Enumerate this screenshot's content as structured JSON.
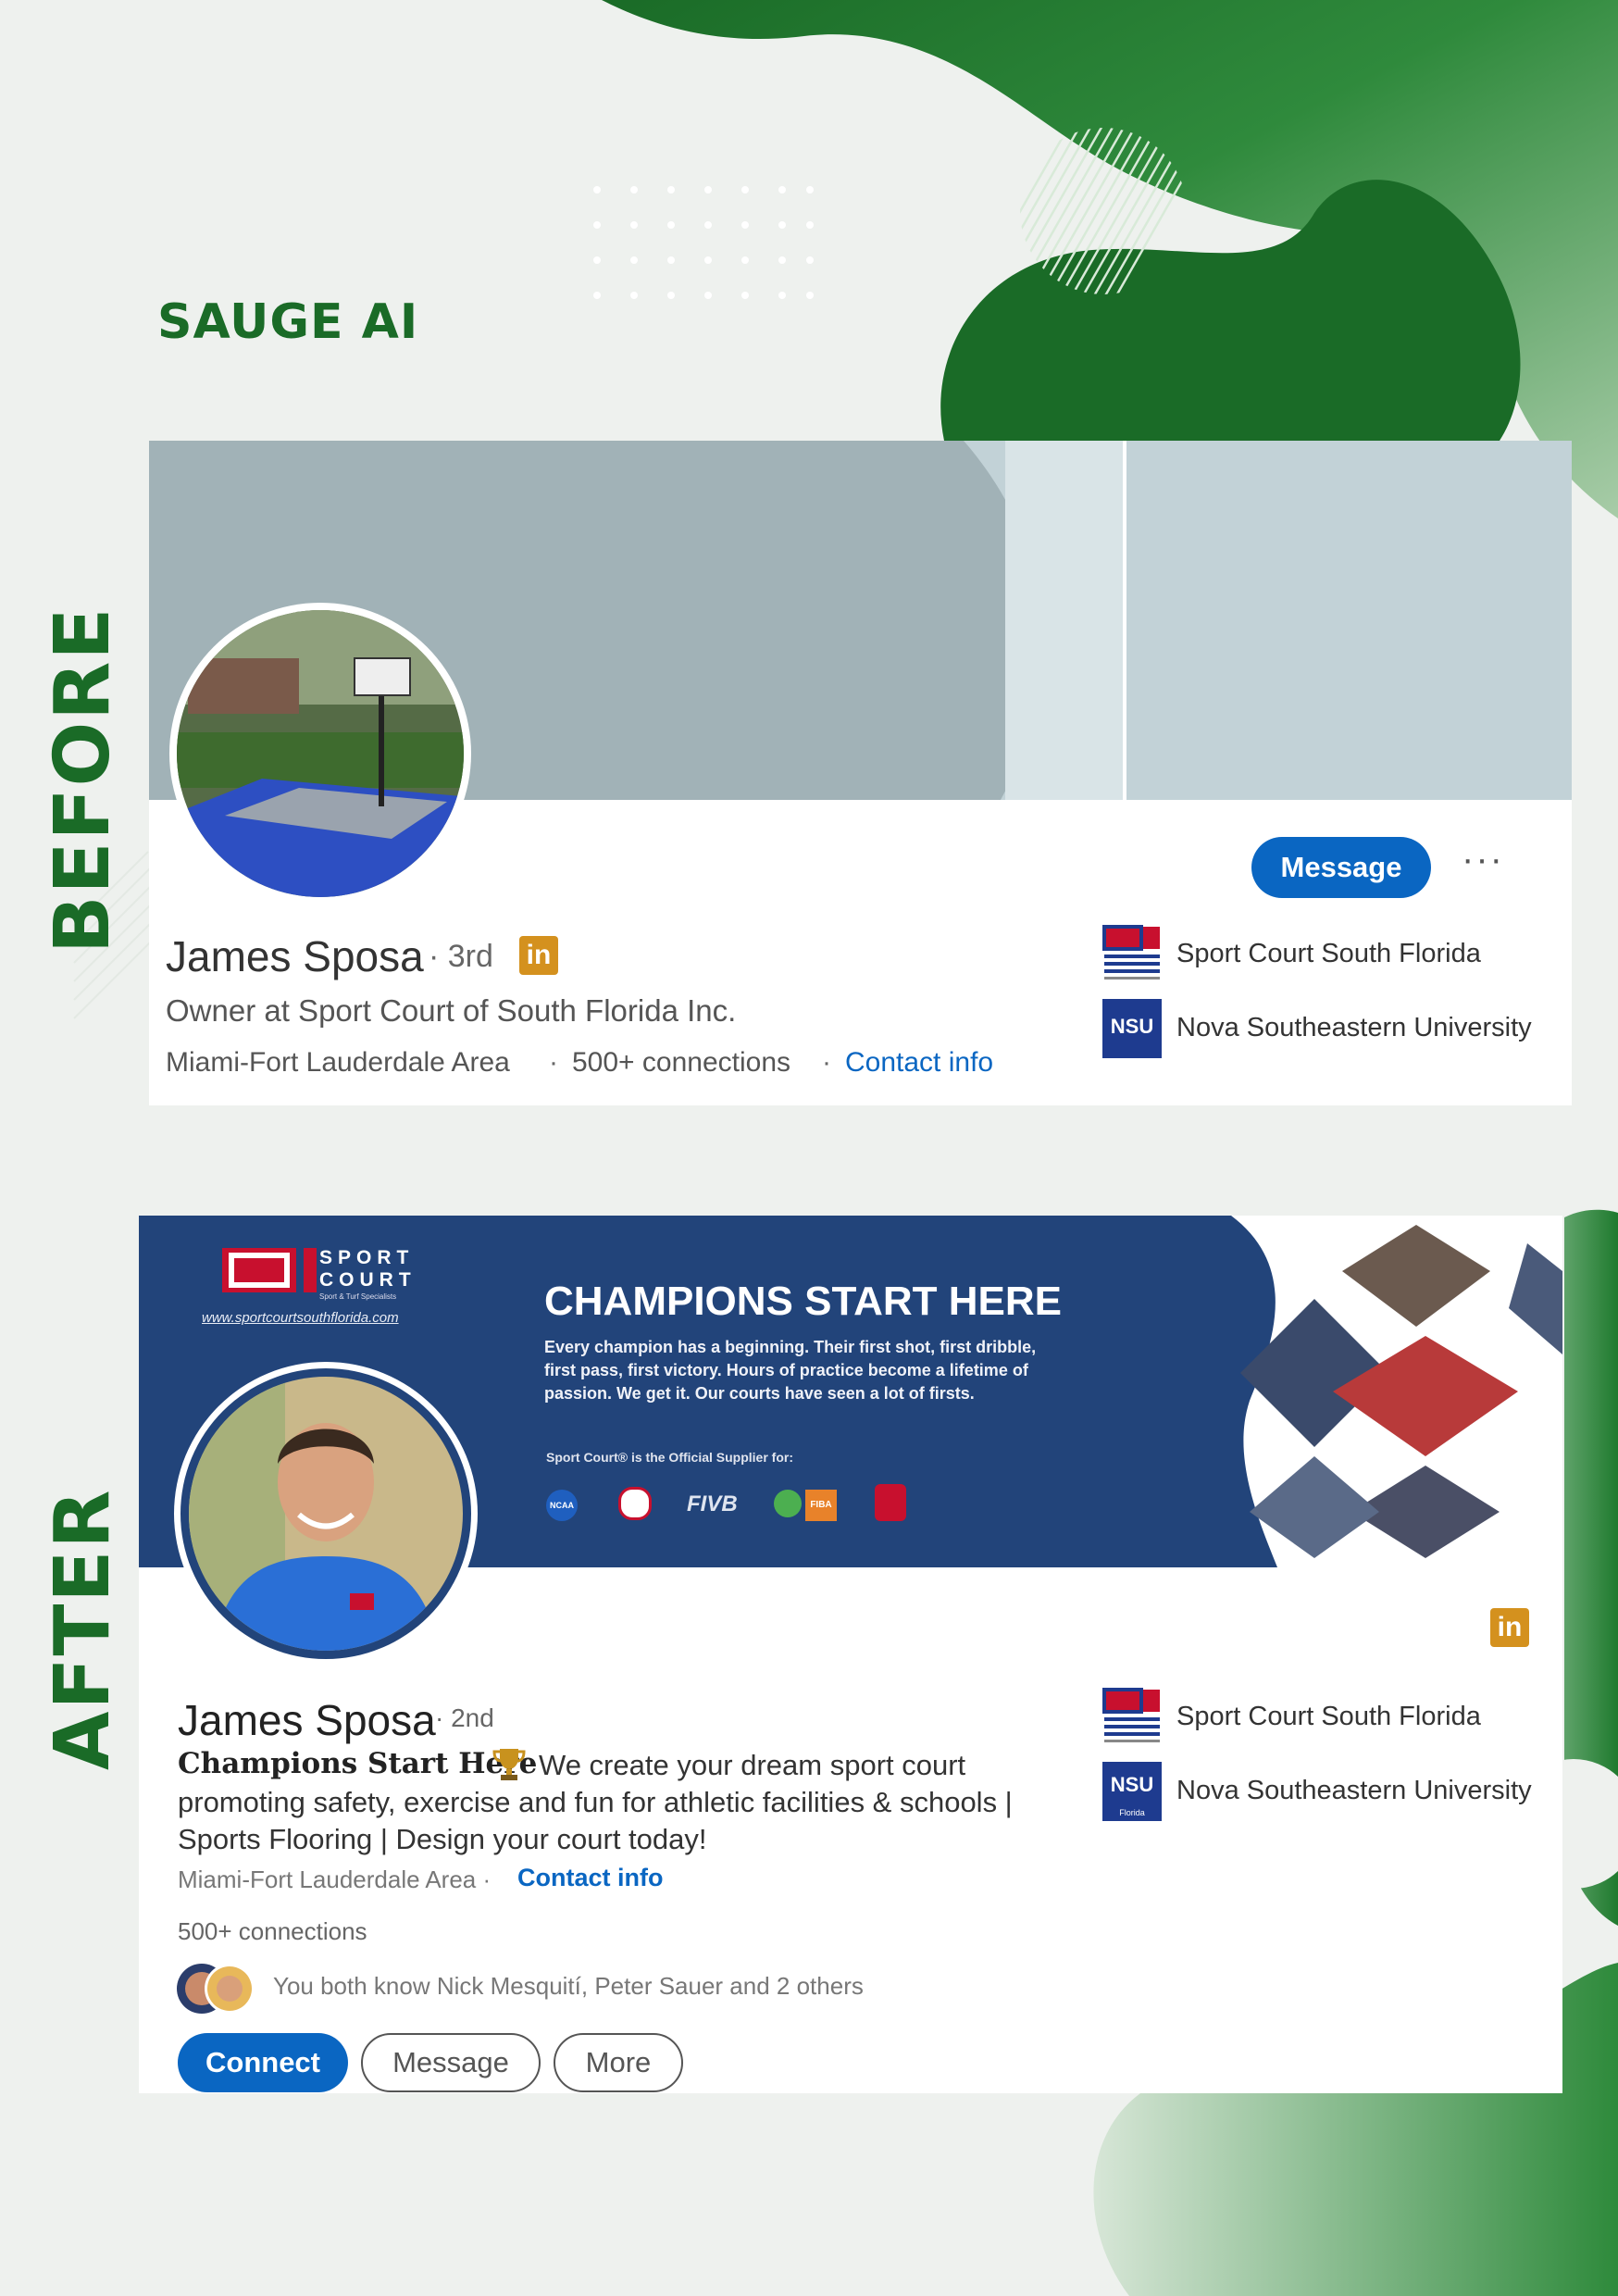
{
  "brand": "SAUGE AI",
  "labels": {
    "before": "BEFORE",
    "after": "AFTER"
  },
  "colors": {
    "brand_green": "#1a6b27",
    "linkedin_blue": "#0a66c2",
    "banner_navy": "#1e3b6e",
    "badge_gold": "#d4911e"
  },
  "before": {
    "name": "James Sposa",
    "degree": "· 3rd",
    "li_badge": "in",
    "headline": "Owner at Sport Court of South Florida Inc.",
    "location": "Miami-Fort Lauderdale Area",
    "sep1": "·",
    "connections": "500+ connections",
    "sep2": "·",
    "contact_info": "Contact info",
    "message_button": "Message",
    "more_icon": "···",
    "orgs": [
      {
        "name": "Sport Court South Florida",
        "logo": "sport-court-logo"
      },
      {
        "name": "Nova Southeastern University",
        "logo": "NSU"
      }
    ]
  },
  "after": {
    "banner": {
      "logo_top": "SPORT",
      "logo_bottom": "COURT",
      "logo_small": "Sport & Turf Specialists",
      "url": "www.sportcourtsouthflorida.com",
      "title": "CHAMPIONS START HERE",
      "body_1": "Every champion has a beginning. Their first shot, first dribble,",
      "body_2": "first pass, first victory. Hours of practice become a lifetime of",
      "body_3": "passion. We get it. Our courts have seen a lot of firsts.",
      "supplier": "Sport Court® is the Official Supplier for:",
      "partners": [
        "NCAA",
        "FIVB",
        "FIBA"
      ]
    },
    "li_badge": "in",
    "name": "James Sposa",
    "degree": "· 2nd",
    "headline_bold": "Champions Start Here",
    "headline_icon": "trophy-icon",
    "headline_1": "We create your dream sport court",
    "headline_2": "promoting safety, exercise and fun for athletic facilities & schools |",
    "headline_3": "Sports Flooring | Design your court today!",
    "location": "Miami-Fort Lauderdale Area ·",
    "contact_info": "Contact info",
    "connections": "500+ connections",
    "mutual": "You both know Nick Mesquití, Peter Sauer and 2 others",
    "buttons": {
      "connect": "Connect",
      "message": "Message",
      "more": "More"
    },
    "orgs": [
      {
        "name": "Sport Court South Florida",
        "logo": "sport-court-logo"
      },
      {
        "name": "Nova Southeastern University",
        "logo": "NSU"
      }
    ],
    "nsu_small": "Florida"
  }
}
